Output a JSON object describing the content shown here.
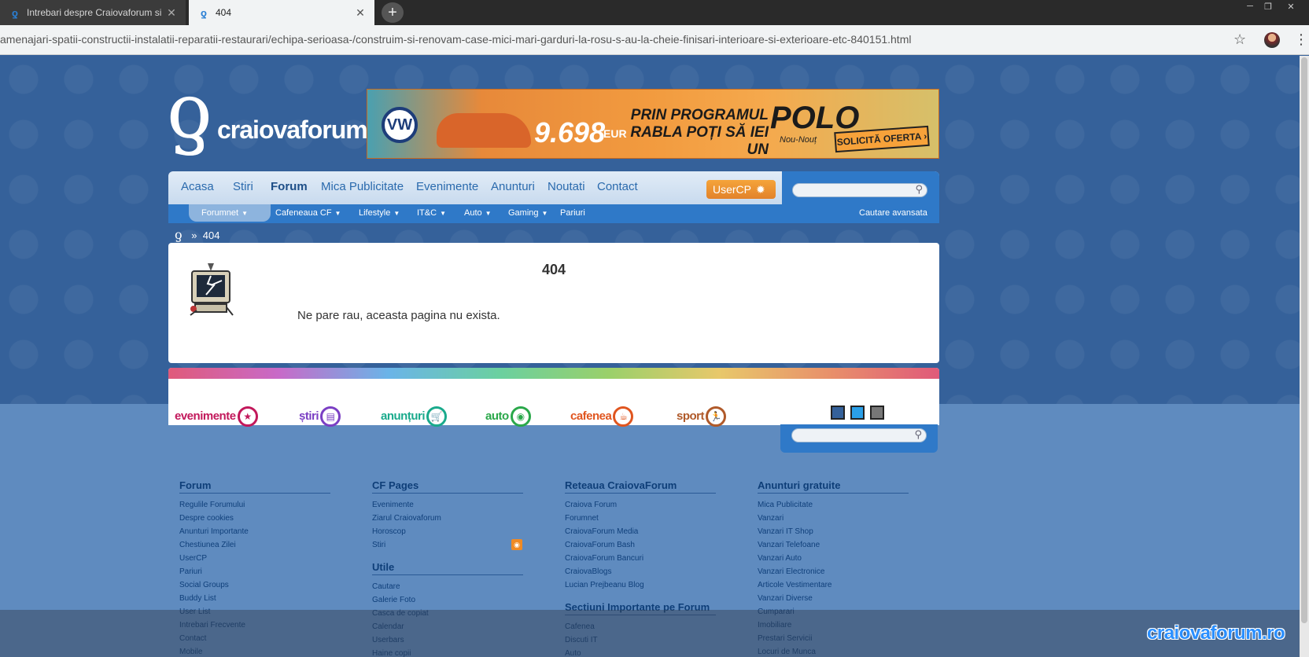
{
  "browser": {
    "tabs": [
      {
        "title": "Intrebari despre Craiovaforum si",
        "active": false
      },
      {
        "title": "404",
        "active": true
      }
    ],
    "url": "amenajari-spatii-constructii-instalatii-reparatii-restaurari/echipa-serioasa-/construim-si-renovam-case-mici-mari-garduri-la-rosu-s-au-la-cheie-finisari-interioare-si-exterioare-etc-840151.html",
    "window_controls": [
      "─",
      "❐",
      "✕"
    ]
  },
  "site": {
    "logo_text": "craiovaforum",
    "banner": {
      "brand": "VW",
      "price": "9.698",
      "currency": "EUR",
      "tagline": "PRIN PROGRAMUL RABLA POȚI SĂ IEI UN",
      "model": "POLO",
      "model_sub": "Nou-Nouț",
      "cta": "SOLICITĂ OFERTA ›"
    },
    "nav": {
      "items": [
        "Acasa",
        "Stiri",
        "Forum",
        "Mica Publicitate",
        "Evenimente",
        "Anunturi",
        "Noutati",
        "Contact"
      ],
      "active": "Forum",
      "usercp": "UserCP",
      "search_placeholder": ""
    },
    "subnav": {
      "items": [
        "Forumnet",
        "Cafeneaua CF",
        "Lifestyle",
        "IT&C",
        "Auto",
        "Gaming",
        "Pariuri"
      ],
      "advanced_search": "Cautare avansata"
    },
    "breadcrumb": {
      "separator": "»",
      "current": "404"
    },
    "error": {
      "title": "404",
      "message": "Ne pare rau, aceasta pagina nu exista."
    },
    "sections": [
      {
        "label": "evenimente",
        "color": "#c2185b",
        "glyph": "★"
      },
      {
        "label": "știri",
        "color": "#7b3fc4",
        "glyph": "▤"
      },
      {
        "label": "anunțuri",
        "color": "#1aaa8c",
        "glyph": "🛒"
      },
      {
        "label": "auto",
        "color": "#2aa84a",
        "glyph": "◉"
      },
      {
        "label": "cafenea",
        "color": "#e0551f",
        "glyph": "☕"
      },
      {
        "label": "sport",
        "color": "#b05a2a",
        "glyph": "🏃"
      }
    ],
    "theme_colors": [
      "#35619a",
      "#2a9fe8",
      "#777777"
    ],
    "footer": {
      "forum": {
        "title": "Forum",
        "links": [
          "Regulile Forumului",
          "Despre cookies",
          "Anunturi Importante",
          "Chestiunea Zilei",
          "UserCP",
          "Pariuri",
          "Social Groups",
          "Buddy List",
          "User List",
          "Intrebari Frecvente",
          "Contact",
          "Mobile"
        ]
      },
      "cf_pages": {
        "title": "CF Pages",
        "links": [
          "Evenimente",
          "Ziarul Craiovaforum",
          "Horoscop",
          "Stiri"
        ]
      },
      "utile": {
        "title": "Utile",
        "links": [
          "Cautare",
          "Galerie Foto",
          "Casca de copiat",
          "Calendar",
          "Userbars",
          "Haine copii"
        ]
      },
      "retea": {
        "title": "Reteaua CraiovaForum",
        "links": [
          "Craiova Forum",
          "Forumnet",
          "CraiovaForum Media",
          "CraiovaForum Bash",
          "CraiovaForum Bancuri",
          "CraiovaBlogs",
          "Lucian Prejbeanu Blog"
        ]
      },
      "sectiuni": {
        "title": "Sectiuni Importante pe Forum",
        "links": [
          "Cafenea",
          "Discuti IT",
          "Auto"
        ]
      },
      "anunturi": {
        "title": "Anunturi gratuite",
        "links": [
          "Mica Publicitate",
          "Vanzari",
          "Vanzari IT Shop",
          "Vanzari Telefoane",
          "Vanzari Auto",
          "Vanzari Electronice",
          "Articole Vestimentare",
          "Vanzari Diverse",
          "Cumparari",
          "Imobiliare",
          "Prestari Servicii",
          "Locuri de Munca"
        ]
      }
    },
    "watermark": "craiovaforum.ro"
  }
}
